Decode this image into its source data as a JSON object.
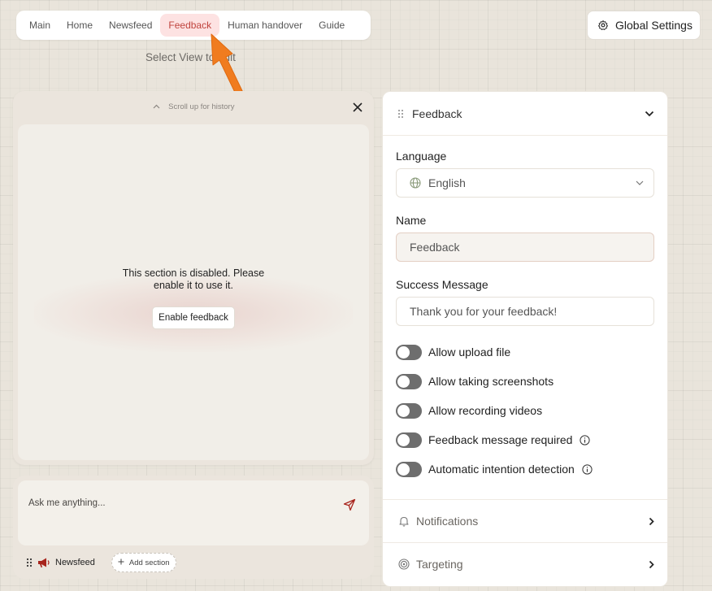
{
  "tabs": [
    {
      "label": "Main",
      "active": false
    },
    {
      "label": "Home",
      "active": false
    },
    {
      "label": "Newsfeed",
      "active": false
    },
    {
      "label": "Feedback",
      "active": true
    },
    {
      "label": "Human handover",
      "active": false
    },
    {
      "label": "Guide",
      "active": false
    }
  ],
  "select_view_hint": "Select View to edit",
  "global_settings_label": "Global Settings",
  "preview": {
    "scroll_hint": "Scroll up for history",
    "disabled_line1": "This section is disabled. Please",
    "disabled_line2": "enable it to use it.",
    "enable_button": "Enable feedback"
  },
  "chat": {
    "placeholder": "Ask me anything...",
    "footer_item": "Newsfeed",
    "add_section": "Add section"
  },
  "settings": {
    "section_title": "Feedback",
    "language_label": "Language",
    "language_value": "English",
    "name_label": "Name",
    "name_value": "Feedback",
    "success_label": "Success Message",
    "success_placeholder": "Thank you for your feedback!",
    "toggles": [
      {
        "label": "Allow upload file",
        "on": false,
        "info": false
      },
      {
        "label": "Allow taking screenshots",
        "on": false,
        "info": false
      },
      {
        "label": "Allow recording videos",
        "on": false,
        "info": false
      },
      {
        "label": "Feedback message required",
        "on": false,
        "info": true
      },
      {
        "label": "Automatic intention detection",
        "on": false,
        "info": true
      }
    ],
    "notifications_label": "Notifications",
    "targeting_label": "Targeting"
  },
  "colors": {
    "accent": "#f07c1f",
    "active_tab_bg": "#fde2e2",
    "active_tab_text": "#c0443e",
    "brand_red": "#a8241c",
    "toggle_off": "#6e6e6e"
  }
}
